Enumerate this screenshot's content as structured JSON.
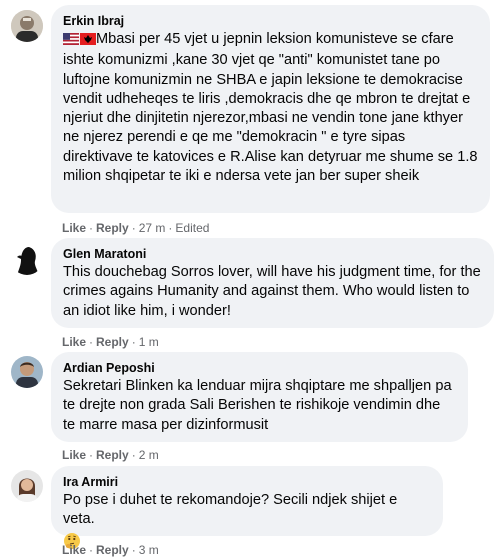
{
  "comments": [
    {
      "author": "Erkin Ibraj",
      "flags": [
        "us-flag-icon",
        "albania-flag-icon"
      ],
      "text": "Mbasi per 45 vjet u jepnin leksion komunisteve se cfare ishte komunizmi ,kane 30 vjet qe \"anti\" komunistet tane po luftojne komunizmin ne SHBA e japin leksione te demokracise vendit udheheqes te liris ,demokracis dhe qe mbron te drejtat e njeriut dhe dinjitetin njerezor,mbasi ne vendin tone jane kthyer ne njerez perendi e qe me \"demokracin \" e tyre sipas direktivave te katovices e R.Alise kan detyruar me shume se 1.8 milion shqipetar te iki e ndersa vete jan ber super sheik",
      "like": "Like",
      "reply": "Reply",
      "time": "27 m",
      "edited": "Edited"
    },
    {
      "author": "Glen Maratoni",
      "text": "This douchebag Sorros lover, will have his judgment time, for the crimes agains Humanity and against them. Who would listen to an idiot like him, i wonder!",
      "like": "Like",
      "reply": "Reply",
      "time": "1 m"
    },
    {
      "author": "Ardian Peposhi",
      "text": "Sekretari Blinken ka lenduar mijra shqiptare me shpalljen pa te drejte non grada Sali Berishen te rishikoje vendimin dhe te marre masa per dizinformusit",
      "like": "Like",
      "reply": "Reply",
      "time": "2 m"
    },
    {
      "author": "Ira Armiri",
      "text": "Po pse i duhet te rekomandoje? Secili ndjek shijet e veta.",
      "emoji": "thinking-face-icon",
      "like": "Like",
      "reply": "Reply",
      "time": "3 m"
    }
  ],
  "separator": "·"
}
